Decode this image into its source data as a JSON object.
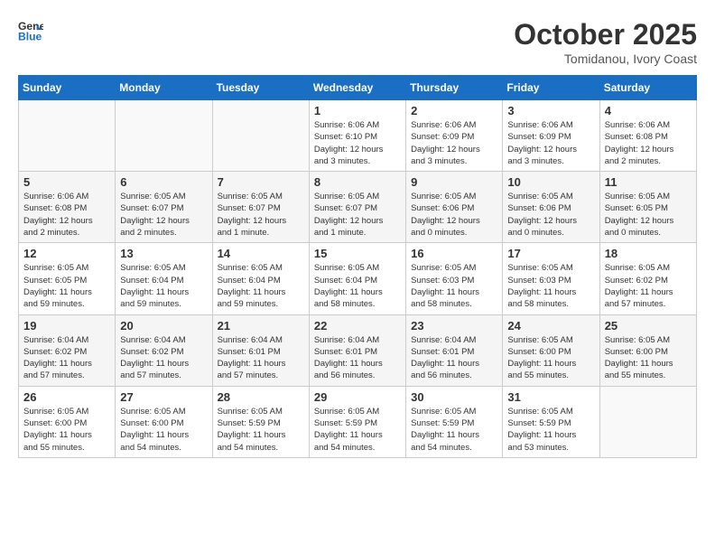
{
  "header": {
    "logo_line1": "General",
    "logo_line2": "Blue",
    "month_year": "October 2025",
    "location": "Tomidanou, Ivory Coast"
  },
  "days_of_week": [
    "Sunday",
    "Monday",
    "Tuesday",
    "Wednesday",
    "Thursday",
    "Friday",
    "Saturday"
  ],
  "weeks": [
    [
      {
        "day": "",
        "info": ""
      },
      {
        "day": "",
        "info": ""
      },
      {
        "day": "",
        "info": ""
      },
      {
        "day": "1",
        "info": "Sunrise: 6:06 AM\nSunset: 6:10 PM\nDaylight: 12 hours\nand 3 minutes."
      },
      {
        "day": "2",
        "info": "Sunrise: 6:06 AM\nSunset: 6:09 PM\nDaylight: 12 hours\nand 3 minutes."
      },
      {
        "day": "3",
        "info": "Sunrise: 6:06 AM\nSunset: 6:09 PM\nDaylight: 12 hours\nand 3 minutes."
      },
      {
        "day": "4",
        "info": "Sunrise: 6:06 AM\nSunset: 6:08 PM\nDaylight: 12 hours\nand 2 minutes."
      }
    ],
    [
      {
        "day": "5",
        "info": "Sunrise: 6:06 AM\nSunset: 6:08 PM\nDaylight: 12 hours\nand 2 minutes."
      },
      {
        "day": "6",
        "info": "Sunrise: 6:05 AM\nSunset: 6:07 PM\nDaylight: 12 hours\nand 2 minutes."
      },
      {
        "day": "7",
        "info": "Sunrise: 6:05 AM\nSunset: 6:07 PM\nDaylight: 12 hours\nand 1 minute."
      },
      {
        "day": "8",
        "info": "Sunrise: 6:05 AM\nSunset: 6:07 PM\nDaylight: 12 hours\nand 1 minute."
      },
      {
        "day": "9",
        "info": "Sunrise: 6:05 AM\nSunset: 6:06 PM\nDaylight: 12 hours\nand 0 minutes."
      },
      {
        "day": "10",
        "info": "Sunrise: 6:05 AM\nSunset: 6:06 PM\nDaylight: 12 hours\nand 0 minutes."
      },
      {
        "day": "11",
        "info": "Sunrise: 6:05 AM\nSunset: 6:05 PM\nDaylight: 12 hours\nand 0 minutes."
      }
    ],
    [
      {
        "day": "12",
        "info": "Sunrise: 6:05 AM\nSunset: 6:05 PM\nDaylight: 11 hours\nand 59 minutes."
      },
      {
        "day": "13",
        "info": "Sunrise: 6:05 AM\nSunset: 6:04 PM\nDaylight: 11 hours\nand 59 minutes."
      },
      {
        "day": "14",
        "info": "Sunrise: 6:05 AM\nSunset: 6:04 PM\nDaylight: 11 hours\nand 59 minutes."
      },
      {
        "day": "15",
        "info": "Sunrise: 6:05 AM\nSunset: 6:04 PM\nDaylight: 11 hours\nand 58 minutes."
      },
      {
        "day": "16",
        "info": "Sunrise: 6:05 AM\nSunset: 6:03 PM\nDaylight: 11 hours\nand 58 minutes."
      },
      {
        "day": "17",
        "info": "Sunrise: 6:05 AM\nSunset: 6:03 PM\nDaylight: 11 hours\nand 58 minutes."
      },
      {
        "day": "18",
        "info": "Sunrise: 6:05 AM\nSunset: 6:02 PM\nDaylight: 11 hours\nand 57 minutes."
      }
    ],
    [
      {
        "day": "19",
        "info": "Sunrise: 6:04 AM\nSunset: 6:02 PM\nDaylight: 11 hours\nand 57 minutes."
      },
      {
        "day": "20",
        "info": "Sunrise: 6:04 AM\nSunset: 6:02 PM\nDaylight: 11 hours\nand 57 minutes."
      },
      {
        "day": "21",
        "info": "Sunrise: 6:04 AM\nSunset: 6:01 PM\nDaylight: 11 hours\nand 57 minutes."
      },
      {
        "day": "22",
        "info": "Sunrise: 6:04 AM\nSunset: 6:01 PM\nDaylight: 11 hours\nand 56 minutes."
      },
      {
        "day": "23",
        "info": "Sunrise: 6:04 AM\nSunset: 6:01 PM\nDaylight: 11 hours\nand 56 minutes."
      },
      {
        "day": "24",
        "info": "Sunrise: 6:05 AM\nSunset: 6:00 PM\nDaylight: 11 hours\nand 55 minutes."
      },
      {
        "day": "25",
        "info": "Sunrise: 6:05 AM\nSunset: 6:00 PM\nDaylight: 11 hours\nand 55 minutes."
      }
    ],
    [
      {
        "day": "26",
        "info": "Sunrise: 6:05 AM\nSunset: 6:00 PM\nDaylight: 11 hours\nand 55 minutes."
      },
      {
        "day": "27",
        "info": "Sunrise: 6:05 AM\nSunset: 6:00 PM\nDaylight: 11 hours\nand 54 minutes."
      },
      {
        "day": "28",
        "info": "Sunrise: 6:05 AM\nSunset: 5:59 PM\nDaylight: 11 hours\nand 54 minutes."
      },
      {
        "day": "29",
        "info": "Sunrise: 6:05 AM\nSunset: 5:59 PM\nDaylight: 11 hours\nand 54 minutes."
      },
      {
        "day": "30",
        "info": "Sunrise: 6:05 AM\nSunset: 5:59 PM\nDaylight: 11 hours\nand 54 minutes."
      },
      {
        "day": "31",
        "info": "Sunrise: 6:05 AM\nSunset: 5:59 PM\nDaylight: 11 hours\nand 53 minutes."
      },
      {
        "day": "",
        "info": ""
      }
    ]
  ]
}
